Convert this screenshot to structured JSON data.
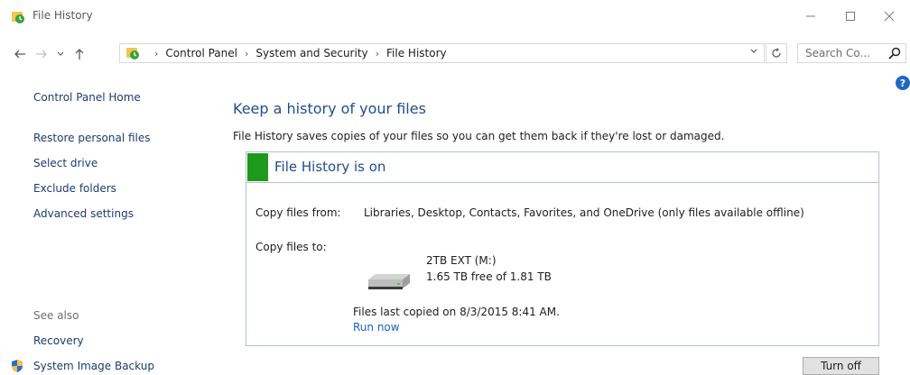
{
  "window": {
    "title": "File History",
    "icons": {
      "app": "file-history-icon",
      "minimize": "minimize-icon",
      "maximize": "maximize-icon",
      "close": "close-icon"
    }
  },
  "nav": {
    "breadcrumbs": [
      "Control Panel",
      "System and Security",
      "File History"
    ],
    "search_placeholder": "Search Co...",
    "icons": {
      "back": "arrow-left-icon",
      "forward": "arrow-right-icon",
      "recent": "chevron-down-icon",
      "up": "arrow-up-icon",
      "refresh": "refresh-icon",
      "search": "search-icon"
    }
  },
  "left_pane": {
    "home": "Control Panel Home",
    "links": [
      "Restore personal files",
      "Select drive",
      "Exclude folders",
      "Advanced settings"
    ],
    "see_also": "See also",
    "see_also_links": [
      "Recovery",
      "System Image Backup"
    ]
  },
  "main": {
    "title": "Keep a history of your files",
    "description": "File History saves copies of your files so you can get them back if they're lost or damaged.",
    "status": "File History is on",
    "copy_from_label": "Copy files from:",
    "copy_from_value": "Libraries, Desktop, Contacts, Favorites, and OneDrive (only files available offline)",
    "copy_to_label": "Copy files to:",
    "drive_name": "2TB EXT (M:)",
    "drive_space": "1.65 TB free of 1.81 TB",
    "last_copied": "Files last copied on 8/3/2015 8:41 AM.",
    "run_now": "Run now",
    "turn_off": "Turn off"
  },
  "colors": {
    "status_on": "#1d9a1b",
    "link": "#1565c0",
    "heading": "#1e4e8c",
    "help": "#1f68c6"
  }
}
